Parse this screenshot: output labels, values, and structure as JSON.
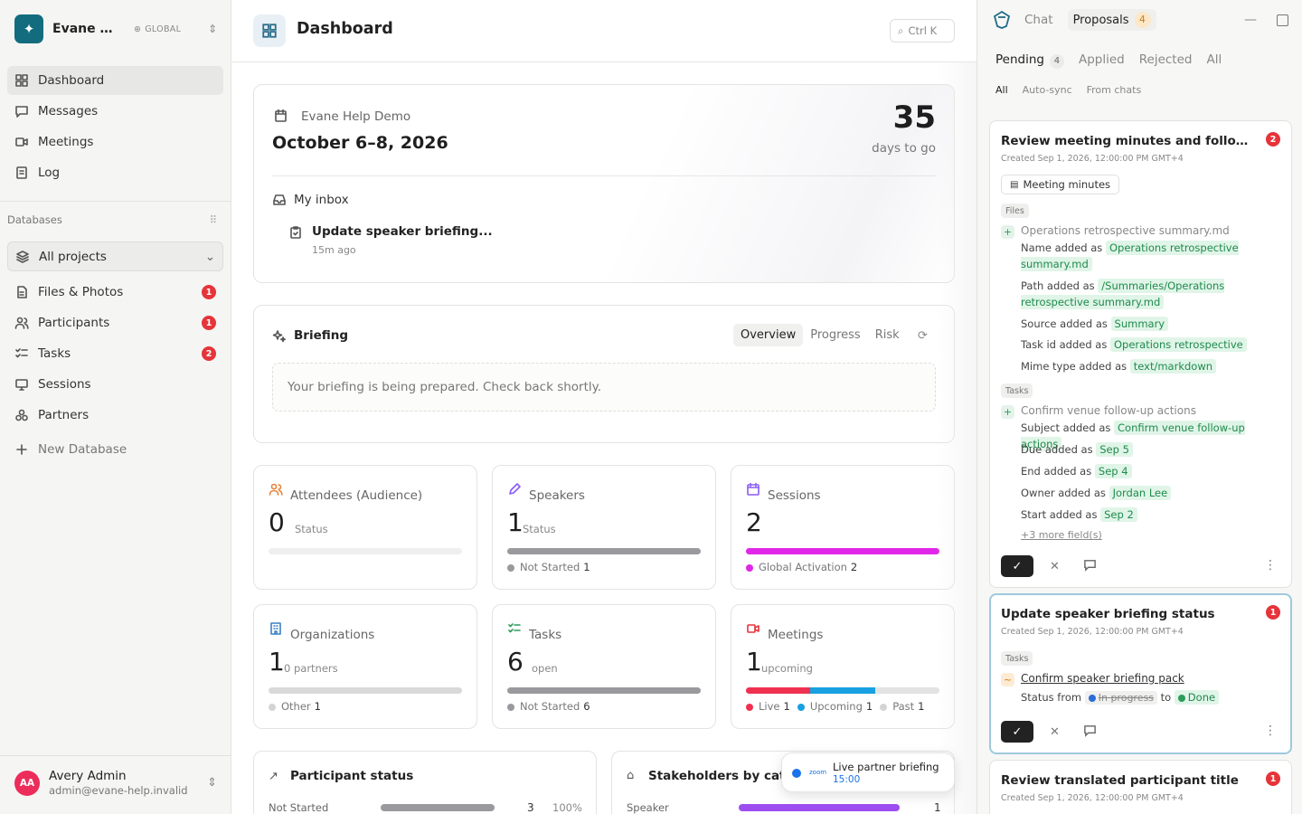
{
  "workspace": {
    "name": "Evane Help Demo",
    "scope": "GLOBAL",
    "accent": "#136c7e"
  },
  "nav": [
    {
      "label": "Dashboard",
      "icon": "dashboard-icon",
      "active": true
    },
    {
      "label": "Messages",
      "icon": "message-icon"
    },
    {
      "label": "Meetings",
      "icon": "video-icon"
    },
    {
      "label": "Log",
      "icon": "log-icon"
    }
  ],
  "databases": {
    "heading": "Databases",
    "selector": "All projects",
    "items": [
      {
        "label": "Files & Photos",
        "icon": "files-icon",
        "badge": "1"
      },
      {
        "label": "Participants",
        "icon": "participants-icon",
        "badge": "1"
      },
      {
        "label": "Tasks",
        "icon": "tasks-icon",
        "badge": "2"
      },
      {
        "label": "Sessions",
        "icon": "sessions-icon",
        "badge": ""
      },
      {
        "label": "Partners",
        "icon": "partners-icon",
        "badge": ""
      }
    ],
    "new": "New Database"
  },
  "user": {
    "initials": "AA",
    "name": "Avery Admin",
    "email": "admin@evane-help.invalid"
  },
  "header": {
    "title": "Dashboard",
    "shortcut": "Ctrl K"
  },
  "event": {
    "label": "Evane Help Demo",
    "dates": "October 6–8, 2026",
    "days": "35",
    "days_label": "days to go"
  },
  "inbox": {
    "heading": "My inbox",
    "item": "Update speaker briefing...",
    "time": "15m ago"
  },
  "briefing": {
    "heading": "Briefing",
    "tabs": [
      "Overview",
      "Progress",
      "Risk"
    ],
    "message": "Your briefing is being prepared. Check back shortly."
  },
  "stats": [
    {
      "title": "Attendees (Audience)",
      "value": "0",
      "sub": "Status",
      "color": "#e8833a",
      "legend": []
    },
    {
      "title": "Speakers",
      "value": "1",
      "sub": "Status",
      "color": "#8b5cf6",
      "legend": [
        {
          "label": "Not Started",
          "count": "1",
          "color": "#9a9a9e"
        }
      ]
    },
    {
      "title": "Sessions",
      "value": "2",
      "sub": "",
      "color": "#8b5cf6",
      "legend": [
        {
          "label": "Global Activation",
          "count": "2",
          "color": "#e026e8"
        }
      ]
    },
    {
      "title": "Organizations",
      "value": "1",
      "sub": "0 partners",
      "color": "#3b82c4",
      "legend": [
        {
          "label": "Other",
          "count": "1",
          "color": "#d4d4d4"
        }
      ]
    },
    {
      "title": "Tasks",
      "value": "6",
      "sub": "open",
      "color": "#2c9b5b",
      "legend": [
        {
          "label": "Not Started",
          "count": "6",
          "color": "#9a9a9e"
        }
      ]
    },
    {
      "title": "Meetings",
      "value": "1",
      "sub": "upcoming",
      "color": "#e5343a",
      "legend": [
        {
          "label": "Live",
          "count": "1",
          "color": "#f0304f"
        },
        {
          "label": "Upcoming",
          "count": "1",
          "color": "#18a0e0"
        },
        {
          "label": "Past",
          "count": "1",
          "color": "#d4d4d4"
        }
      ]
    }
  ],
  "participant_status": {
    "title": "Participant status",
    "row": {
      "label": "Not Started",
      "count": "3",
      "pct": "100%"
    }
  },
  "stakeholders": {
    "title": "Stakeholders by categ",
    "row": {
      "label": "Speaker",
      "count": "1"
    }
  },
  "toast": {
    "brand": "zoom",
    "title": "Live partner briefing",
    "time": "15:00"
  },
  "panel": {
    "tabs": {
      "chat": "Chat",
      "proposals": "Proposals",
      "count": "4"
    },
    "filters": {
      "pending": "Pending",
      "pending_count": "4",
      "applied": "Applied",
      "rejected": "Rejected",
      "all": "All"
    },
    "sources": [
      "All",
      "Auto-sync",
      "From chats"
    ],
    "cards": [
      {
        "title": "Review meeting minutes and follow-up tasks",
        "badge": "2",
        "created": "Created Sep 1, 2026, 12:00:00 PM GMT+4",
        "chip": "Meeting minutes",
        "s1": "Files",
        "item1": "Operations retrospective summary.md",
        "f": [
          {
            "k": "Name added as",
            "v": "Operations retrospective summary.md"
          },
          {
            "k": "Path added as",
            "v": "/Summaries/Operations retrospective summary.md"
          },
          {
            "k": "Source added as",
            "v": "Summary"
          },
          {
            "k": "Task id added as",
            "v": "Operations retrospective"
          },
          {
            "k": "Mime type added as",
            "v": "text/markdown"
          }
        ],
        "s2": "Tasks",
        "item2": "Confirm venue follow-up actions",
        "g": [
          {
            "k": "Subject added as",
            "v": "Confirm venue follow-up actions"
          },
          {
            "k": "Due added as",
            "v": "Sep 5"
          },
          {
            "k": "End added as",
            "v": "Sep 4"
          },
          {
            "k": "Owner added as",
            "v": "Jordan Lee"
          },
          {
            "k": "Start added as",
            "v": "Sep 2"
          }
        ],
        "more": "+3 more field(s)"
      },
      {
        "title": "Update speaker briefing status",
        "badge": "1",
        "created": "Created Sep 1, 2026, 12:00:00 PM GMT+4",
        "s1": "Tasks",
        "item1": "Confirm speaker briefing pack",
        "status_label": "Status from",
        "from": "In progress",
        "to_word": "to",
        "to": "Done"
      },
      {
        "title": "Review translated participant title",
        "badge": "1",
        "created": "Created Sep 1, 2026, 12:00:00 PM GMT+4"
      }
    ]
  }
}
